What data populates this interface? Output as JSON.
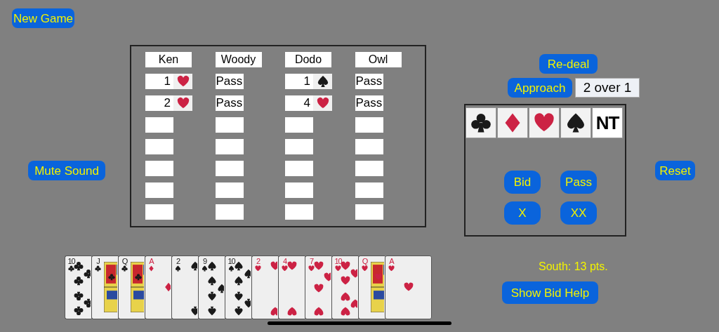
{
  "top_buttons": [
    {
      "label": "New Game"
    }
  ],
  "mute_button": {
    "label": "Mute Sound"
  },
  "bidding_table": {
    "players": [
      {
        "name": "Ken",
        "calls": [
          {
            "kind": "hearts",
            "level": "1"
          },
          {
            "kind": "hearts",
            "level": "2"
          },
          {
            "kind": "empty"
          },
          {
            "kind": "empty"
          },
          {
            "kind": "empty"
          },
          {
            "kind": "empty"
          },
          {
            "kind": "empty"
          }
        ]
      },
      {
        "name": "Woody",
        "calls": [
          {
            "kind": "pass",
            "text": "Pass"
          },
          {
            "kind": "pass",
            "text": "Pass"
          },
          {
            "kind": "empty"
          },
          {
            "kind": "empty"
          },
          {
            "kind": "empty"
          },
          {
            "kind": "empty"
          },
          {
            "kind": "empty"
          }
        ]
      },
      {
        "name": "Dodo",
        "calls": [
          {
            "kind": "spades",
            "level": "1"
          },
          {
            "kind": "hearts",
            "level": "4"
          },
          {
            "kind": "empty"
          },
          {
            "kind": "empty"
          },
          {
            "kind": "empty"
          },
          {
            "kind": "empty"
          },
          {
            "kind": "empty"
          }
        ]
      },
      {
        "name": "Owl",
        "calls": [
          {
            "kind": "pass",
            "text": "Pass"
          },
          {
            "kind": "pass",
            "text": "Pass"
          },
          {
            "kind": "empty"
          },
          {
            "kind": "empty"
          },
          {
            "kind": "empty"
          },
          {
            "kind": "empty"
          },
          {
            "kind": "empty"
          }
        ]
      }
    ]
  },
  "redeal_button": {
    "label": "Re-deal"
  },
  "approach": {
    "button": "Approach",
    "value": "2 over 1"
  },
  "bid_panel": {
    "strains": [
      {
        "kind": "clubs"
      },
      {
        "kind": "diamonds"
      },
      {
        "kind": "hearts"
      },
      {
        "kind": "spades"
      },
      {
        "kind": "nt",
        "label": "NT"
      }
    ],
    "buttons": [
      "Bid",
      "Pass",
      "X",
      "XX"
    ]
  },
  "reset_button": {
    "label": "Reset"
  },
  "hand": [
    {
      "rank": "10",
      "kind": "clubs",
      "face": false
    },
    {
      "rank": "J",
      "kind": "clubs",
      "face": true
    },
    {
      "rank": "Q",
      "kind": "clubs",
      "face": true
    },
    {
      "rank": "A",
      "kind": "diamonds",
      "face": false
    },
    {
      "rank": "2",
      "kind": "spades",
      "face": false
    },
    {
      "rank": "9",
      "kind": "spades",
      "face": false
    },
    {
      "rank": "10",
      "kind": "spades",
      "face": false
    },
    {
      "rank": "2",
      "kind": "hearts",
      "face": false
    },
    {
      "rank": "4",
      "kind": "hearts",
      "face": false
    },
    {
      "rank": "7",
      "kind": "hearts",
      "face": false
    },
    {
      "rank": "10",
      "kind": "hearts",
      "face": false
    },
    {
      "rank": "Q",
      "kind": "hearts",
      "face": true
    },
    {
      "rank": "A",
      "kind": "hearts",
      "face": false
    }
  ],
  "points": "South: 13 pts.",
  "help_button": {
    "label": "Show Bid Help"
  }
}
